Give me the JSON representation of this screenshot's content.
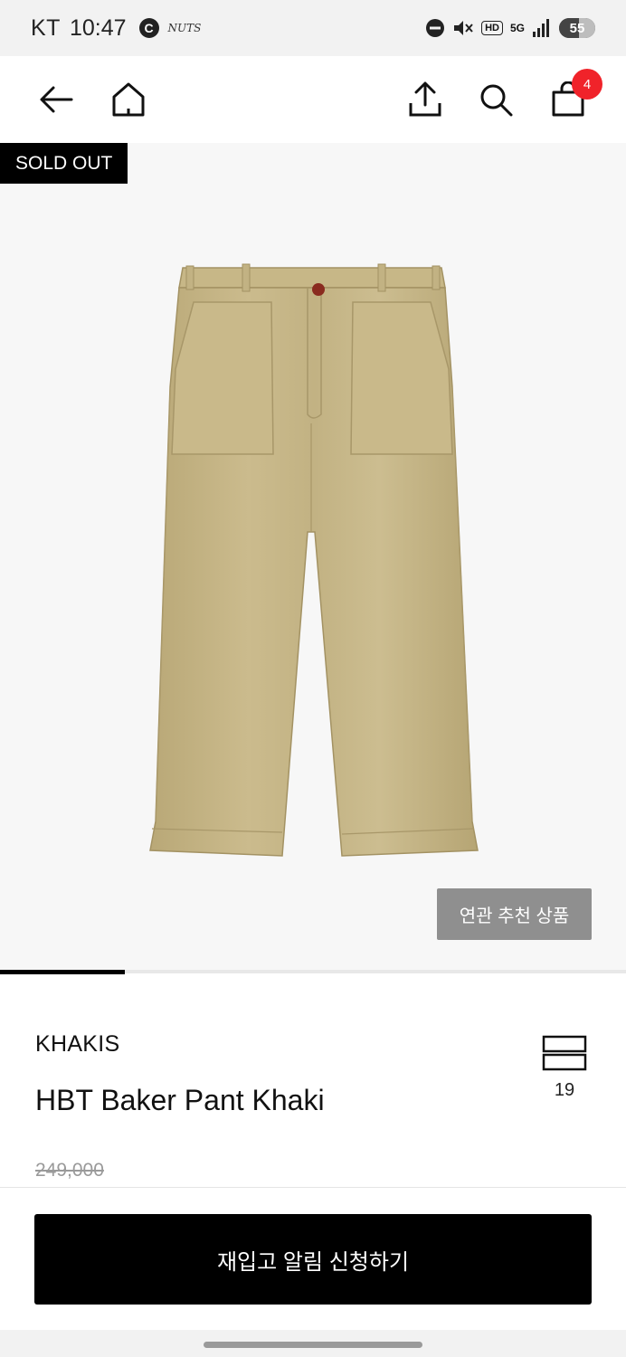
{
  "status_bar": {
    "carrier": "KT",
    "time": "10:47",
    "c_icon_letter": "C",
    "app_icon_text": "NUTS",
    "network": "5G",
    "hd": "HD",
    "battery": "55",
    "battery_level_percent": 55
  },
  "header": {
    "back_icon": "arrow-left-icon",
    "home_icon": "home-icon",
    "share_icon": "share-icon",
    "search_icon": "search-icon",
    "cart_icon": "shopping-bag-icon",
    "cart_count": "4"
  },
  "product": {
    "sold_out_label": "SOLD OUT",
    "related_button_label": "연관 추천 상품",
    "gallery_progress_fraction": 0.2,
    "brand": "KHAKIS",
    "title": "HBT Baker Pant Khaki",
    "price": "249,000",
    "wishlist_count": "19"
  },
  "cta": {
    "label": "재입고 알림 신청하기"
  },
  "colors": {
    "accent": "#000000",
    "badge": "#f0232a",
    "pant": "#c4b483"
  }
}
